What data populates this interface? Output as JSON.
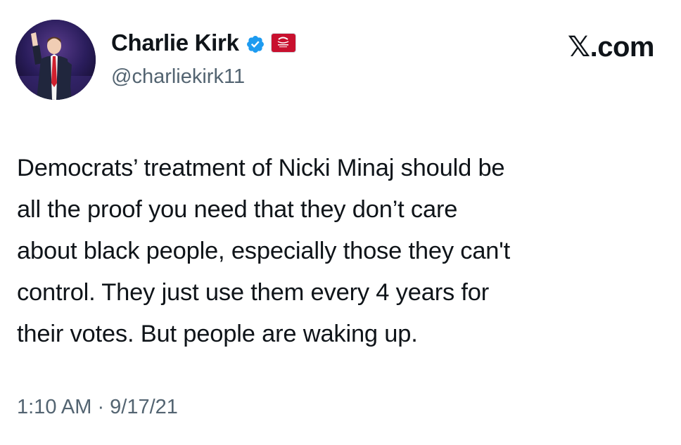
{
  "author": {
    "display_name": "Charlie Kirk",
    "handle": "@charliekirk11",
    "verified": true,
    "verified_color": "#1d9bf0",
    "affiliate_badge_color": "#c8102e"
  },
  "brand": {
    "label": "𝕏.com"
  },
  "tweet": {
    "lines": [
      "Democrats’ treatment of Nicki Minaj should be",
      "all the proof you need that they don’t care",
      "about black people, especially those they can't",
      "control. They just use them every 4 years for",
      "their votes. But people are waking up."
    ],
    "timestamp": "1:10 AM · 9/17/21"
  },
  "colors": {
    "text_primary": "#0f1419",
    "text_secondary": "#536471",
    "background": "#ffffff"
  }
}
